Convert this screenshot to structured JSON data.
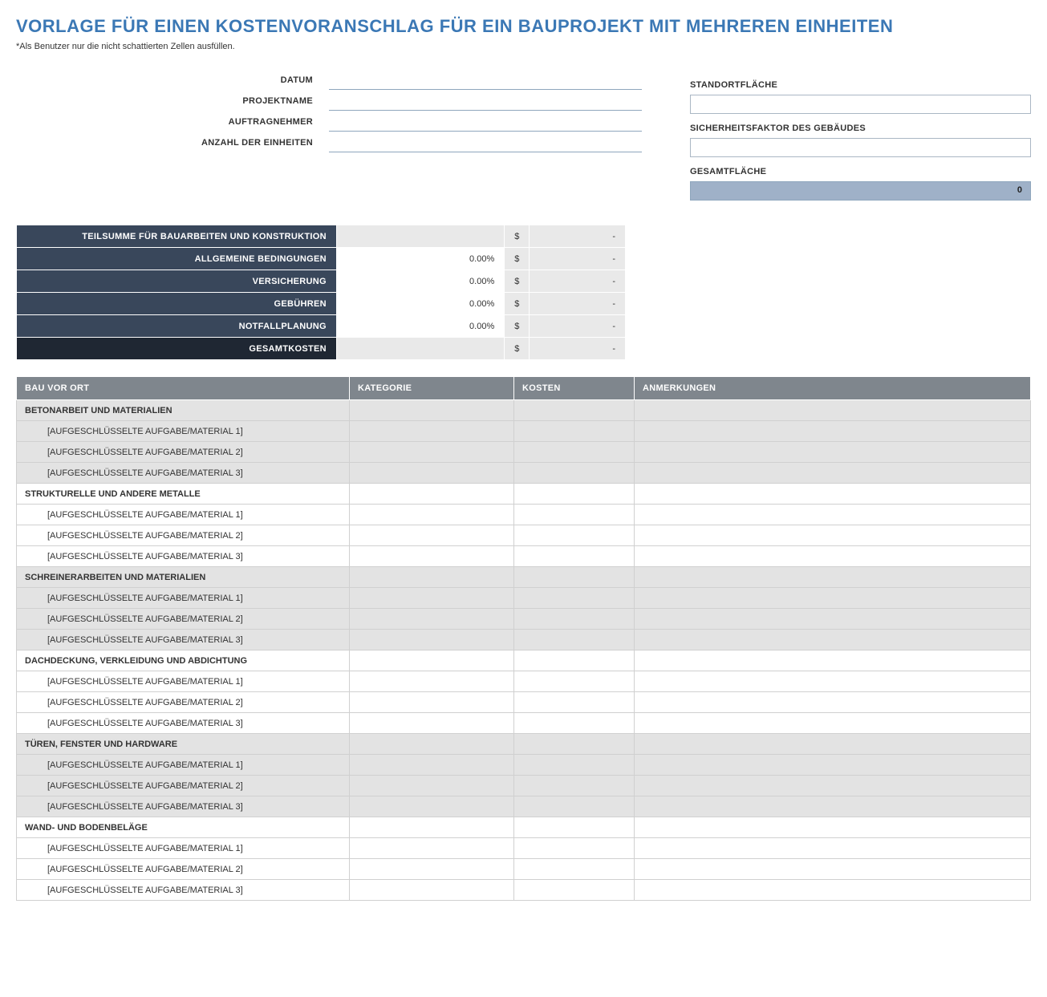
{
  "title": "VORLAGE FÜR EINEN KOSTENVORANSCHLAG FÜR EIN BAUPROJEKT MIT MEHREREN EINHEITEN",
  "note": "*Als Benutzer nur die nicht schattierten Zellen ausfüllen.",
  "meta_left": {
    "date_label": "DATUM",
    "project_label": "PROJEKTNAME",
    "contractor_label": "AUFTRAGNEHMER",
    "units_label": "ANZAHL DER EINHEITEN",
    "date_value": "",
    "project_value": "",
    "contractor_value": "",
    "units_value": ""
  },
  "meta_right": {
    "site_area_label": "STANDORTFLÄCHE",
    "site_area_value": "",
    "safety_label": "SICHERHEITSFAKTOR DES GEBÄUDES",
    "safety_value": "",
    "total_area_label": "GESAMTFLÄCHE",
    "total_area_value": "0"
  },
  "summary": {
    "rows": [
      {
        "label": "TEILSUMME FÜR BAUARBEITEN UND KONSTRUKTION",
        "pct": "",
        "currency": "$",
        "value": "-",
        "dark": false,
        "pct_shade": true
      },
      {
        "label": "ALLGEMEINE BEDINGUNGEN",
        "pct": "0.00%",
        "currency": "$",
        "value": "-",
        "dark": false,
        "pct_shade": false
      },
      {
        "label": "VERSICHERUNG",
        "pct": "0.00%",
        "currency": "$",
        "value": "-",
        "dark": false,
        "pct_shade": false
      },
      {
        "label": "GEBÜHREN",
        "pct": "0.00%",
        "currency": "$",
        "value": "-",
        "dark": false,
        "pct_shade": false
      },
      {
        "label": "NOTFALLPLANUNG",
        "pct": "0.00%",
        "currency": "$",
        "value": "-",
        "dark": false,
        "pct_shade": false
      },
      {
        "label": "GESAMTKOSTEN",
        "pct": "",
        "currency": "$",
        "value": "-",
        "dark": true,
        "pct_shade": true
      }
    ]
  },
  "work_headers": {
    "desc": "BAU VOR ORT",
    "cat": "KATEGORIE",
    "cost": "KOSTEN",
    "note": "ANMERKUNGEN"
  },
  "work_sections": [
    {
      "title": "BETONARBEIT UND MATERIALIEN",
      "shade": true,
      "items": [
        "[AUFGESCHLÜSSELTE AUFGABE/MATERIAL 1]",
        "[AUFGESCHLÜSSELTE AUFGABE/MATERIAL 2]",
        "[AUFGESCHLÜSSELTE AUFGABE/MATERIAL 3]"
      ]
    },
    {
      "title": "STRUKTURELLE UND ANDERE METALLE",
      "shade": false,
      "items": [
        "[AUFGESCHLÜSSELTE AUFGABE/MATERIAL 1]",
        "[AUFGESCHLÜSSELTE AUFGABE/MATERIAL 2]",
        "[AUFGESCHLÜSSELTE AUFGABE/MATERIAL 3]"
      ]
    },
    {
      "title": "SCHREINERARBEITEN UND MATERIALIEN",
      "shade": true,
      "items": [
        "[AUFGESCHLÜSSELTE AUFGABE/MATERIAL 1]",
        "[AUFGESCHLÜSSELTE AUFGABE/MATERIAL 2]",
        "[AUFGESCHLÜSSELTE AUFGABE/MATERIAL 3]"
      ]
    },
    {
      "title": "DACHDECKUNG, VERKLEIDUNG UND ABDICHTUNG",
      "shade": false,
      "items": [
        "[AUFGESCHLÜSSELTE AUFGABE/MATERIAL 1]",
        "[AUFGESCHLÜSSELTE AUFGABE/MATERIAL 2]",
        "[AUFGESCHLÜSSELTE AUFGABE/MATERIAL 3]"
      ]
    },
    {
      "title": "TÜREN, FENSTER UND HARDWARE",
      "shade": true,
      "items": [
        "[AUFGESCHLÜSSELTE AUFGABE/MATERIAL 1]",
        "[AUFGESCHLÜSSELTE AUFGABE/MATERIAL 2]",
        "[AUFGESCHLÜSSELTE AUFGABE/MATERIAL 3]"
      ]
    },
    {
      "title": "WAND- UND BODENBELÄGE",
      "shade": false,
      "items": [
        "[AUFGESCHLÜSSELTE AUFGABE/MATERIAL 1]",
        "[AUFGESCHLÜSSELTE AUFGABE/MATERIAL 2]",
        "[AUFGESCHLÜSSELTE AUFGABE/MATERIAL 3]"
      ]
    }
  ]
}
